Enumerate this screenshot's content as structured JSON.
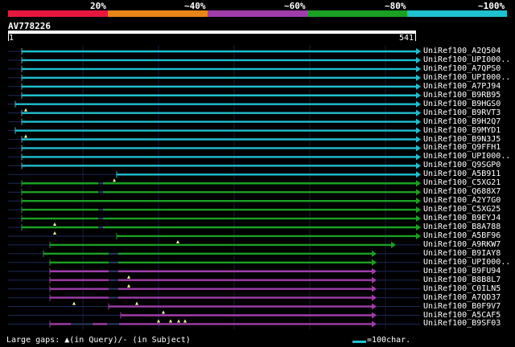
{
  "legend": {
    "labels": [
      "20%",
      "~40%",
      "~60%",
      "~80%",
      "~100%"
    ],
    "colors": [
      "#e8173d",
      "#e88519",
      "#a03daa",
      "#1aa023",
      "#1fc0cf"
    ]
  },
  "query": {
    "name": "AV778226",
    "start": "1",
    "end": "541"
  },
  "hits": [
    {
      "name": "UniRef100_A2Q504",
      "color_index": 4,
      "arrow": true
    },
    {
      "name": "UniRef100_UPI000..",
      "color_index": 4,
      "arrow": true
    },
    {
      "name": "UniRef100_A7QPS0",
      "color_index": 4,
      "arrow": true
    },
    {
      "name": "UniRef100_UPI000..",
      "color_index": 4,
      "arrow": true
    },
    {
      "name": "UniRef100_A7PJ94",
      "color_index": 4,
      "arrow": true
    },
    {
      "name": "UniRef100_B9RB95",
      "color_index": 4,
      "arrow": true
    },
    {
      "name": "UniRef100_B9HGS0",
      "color_index": 4,
      "arrow": true
    },
    {
      "name": "UniRef100_B9RVT3",
      "color_index": 4,
      "arrow": true
    },
    {
      "name": "UniRef100_B9H2Q7",
      "color_index": 4,
      "arrow": true
    },
    {
      "name": "UniRef100_B9MYD1",
      "color_index": 4,
      "arrow": true
    },
    {
      "name": "UniRef100_B9N3J5",
      "color_index": 4,
      "arrow": true
    },
    {
      "name": "UniRef100_Q9FFH1",
      "color_index": 4,
      "arrow": true
    },
    {
      "name": "UniRef100_UPI000..",
      "color_index": 4,
      "arrow": true
    },
    {
      "name": "UniRef100_Q9SGP0",
      "color_index": 4,
      "arrow": true
    },
    {
      "name": "UniRef100_A5B911",
      "color_index": 4,
      "arrow": true
    },
    {
      "name": "UniRef100_C5XG21",
      "color_index": 3,
      "arrow": true
    },
    {
      "name": "UniRef100_Q688X7",
      "color_index": 3,
      "arrow": true
    },
    {
      "name": "UniRef100_A2Y7G0",
      "color_index": 3,
      "arrow": true
    },
    {
      "name": "UniRef100_C5XG25",
      "color_index": 3,
      "arrow": true
    },
    {
      "name": "UniRef100_B9EYJ4",
      "color_index": 3,
      "arrow": true
    },
    {
      "name": "UniRef100_B8A788",
      "color_index": 3,
      "arrow": true
    },
    {
      "name": "UniRef100_A5BF96",
      "color_index": 3,
      "arrow": true
    },
    {
      "name": "UniRef100_A9RKW7",
      "color_index": 3,
      "arrow": true
    },
    {
      "name": "UniRef100_B9IAY8",
      "color_index": 3,
      "arrow": true
    },
    {
      "name": "UniRef100_UPI000..",
      "color_index": 3,
      "arrow": true
    },
    {
      "name": "UniRef100_B9FU94",
      "color_index": 2,
      "arrow": true
    },
    {
      "name": "UniRef100_B8B8L7",
      "color_index": 2,
      "arrow": true
    },
    {
      "name": "UniRef100_C0ILN5",
      "color_index": 2,
      "arrow": true
    },
    {
      "name": "UniRef100_A7QD37",
      "color_index": 2,
      "arrow": true
    },
    {
      "name": "UniRef100_B0F9V7",
      "color_index": 2,
      "arrow": true
    },
    {
      "name": "UniRef100_A5CAF5",
      "color_index": 2,
      "arrow": true
    },
    {
      "name": "UniRef100_B9SF03",
      "color_index": 2,
      "arrow": true
    }
  ],
  "footer": {
    "gaps_text": "Large gaps: ▲(in Query)/- (in Subject)",
    "scale_text": "=100char."
  }
}
